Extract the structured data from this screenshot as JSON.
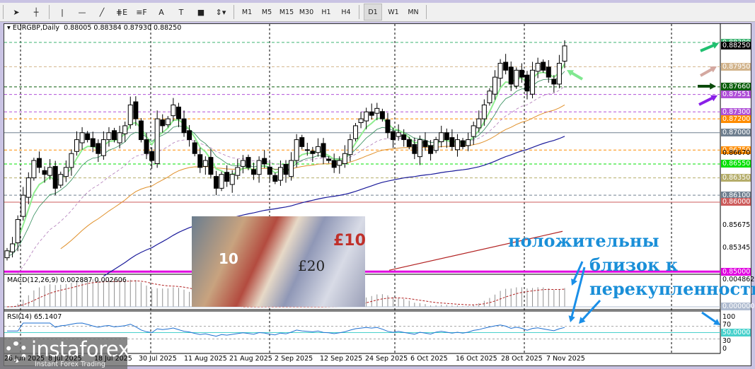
{
  "toolbar": {
    "tools": [
      {
        "name": "cursor-icon",
        "glyph": "➤"
      },
      {
        "name": "crosshair-icon",
        "glyph": "┼"
      },
      {
        "name": "vertical-line-icon",
        "glyph": "|"
      },
      {
        "name": "horizontal-line-icon",
        "glyph": "—"
      },
      {
        "name": "trendline-icon",
        "glyph": "╱"
      },
      {
        "name": "fibonacci-icon",
        "glyph": "⋕E"
      },
      {
        "name": "fibo-levels-icon",
        "glyph": "≡F"
      },
      {
        "name": "text-icon",
        "glyph": "A"
      },
      {
        "name": "text-label-icon",
        "glyph": "T"
      },
      {
        "name": "rectangle-icon",
        "glyph": "■"
      },
      {
        "name": "arrows-dropdown-icon",
        "glyph": "⇕▾"
      }
    ],
    "timeframes": [
      "M1",
      "M5",
      "M15",
      "M30",
      "H1",
      "H4",
      "D1",
      "W1",
      "MN"
    ],
    "active_timeframe": "D1"
  },
  "chart_data": {
    "type": "candlestick",
    "title": "EURGBP,Daily",
    "ohlc_header": "0.88005 0.88384 0.87930 0.88250",
    "ylim": [
      0.8495,
      0.8842
    ],
    "closes": [
      0.853,
      0.854,
      0.8575,
      0.861,
      0.8635,
      0.866,
      0.865,
      0.864,
      0.865,
      0.862,
      0.864,
      0.865,
      0.867,
      0.869,
      0.87,
      0.869,
      0.868,
      0.867,
      0.869,
      0.87,
      0.869,
      0.87,
      0.871,
      0.874,
      0.872,
      0.869,
      0.867,
      0.866,
      0.872,
      0.871,
      0.872,
      0.874,
      0.872,
      0.87,
      0.869,
      0.867,
      0.865,
      0.866,
      0.864,
      0.862,
      0.864,
      0.863,
      0.864,
      0.865,
      0.866,
      0.865,
      0.864,
      0.866,
      0.8655,
      0.864,
      0.863,
      0.865,
      0.864,
      0.866,
      0.869,
      0.868,
      0.8675,
      0.867,
      0.868,
      0.8665,
      0.866,
      0.865,
      0.866,
      0.867,
      0.869,
      0.871,
      0.872,
      0.873,
      0.8725,
      0.8735,
      0.872,
      0.87,
      0.869,
      0.87,
      0.869,
      0.868,
      0.867,
      0.869,
      0.868,
      0.867,
      0.869,
      0.87,
      0.869,
      0.868,
      0.869,
      0.868,
      0.869,
      0.871,
      0.872,
      0.874,
      0.876,
      0.878,
      0.88,
      0.879,
      0.877,
      0.879,
      0.878,
      0.876,
      0.879,
      0.88,
      0.879,
      0.878,
      0.877,
      0.88,
      0.8825
    ],
    "red_trend": [
      0.8502,
      0.8558
    ],
    "levels": [
      {
        "price": 0.883,
        "label": "0.88300",
        "color": "#3cb371",
        "style": "dash"
      },
      {
        "price": 0.8825,
        "label": "0.88250",
        "color": "#000000",
        "style": "none"
      },
      {
        "price": 0.8795,
        "label": "0.87950",
        "color": "#d2b48c",
        "style": "dash"
      },
      {
        "price": 0.8766,
        "label": "0.87660",
        "color": "#0b5e0b",
        "style": "dash"
      },
      {
        "price": 0.87551,
        "label": "0.87551",
        "color": "#b050d8",
        "style": "dash"
      },
      {
        "price": 0.873,
        "label": "0.87300",
        "color": "#b050d8",
        "style": "dash"
      },
      {
        "price": 0.872,
        "label": "0.87200",
        "color": "#ff8c00",
        "style": "dash"
      },
      {
        "price": 0.87,
        "label": "0.87000",
        "color": "#708090",
        "style": "solid"
      },
      {
        "price": 0.8675,
        "label": "0.86750",
        "color": "#ff8c00",
        "style": "dash"
      },
      {
        "price": 0.8655,
        "label": "0.86550",
        "color": "#00e000",
        "style": "dash"
      },
      {
        "price": 0.8635,
        "label": "0.86350",
        "color": "#b5ad6a",
        "style": "dash"
      },
      {
        "price": 0.861,
        "label": "0.86100",
        "color": "#708090",
        "style": "dash"
      },
      {
        "price": 0.86,
        "label": "0.86000",
        "color": "#cd5c5c",
        "style": "solid"
      },
      {
        "price": 0.85,
        "label": "0.85000",
        "color": "#e000e0",
        "style": "thick"
      }
    ],
    "price_ticks": [
      "0.86670",
      "0.85675",
      "0.85345"
    ],
    "macd": {
      "label": "MACD(12,26,9) 0.002887 0.002606",
      "max": "0.004862",
      "zero": "0.000000"
    },
    "rsi": {
      "label": "RSI(14) 65.1407",
      "ticks": [
        "100",
        "70",
        "30",
        "0"
      ],
      "level": "50.0000"
    },
    "xaxis": {
      "labels": [
        "26 Jun 2025",
        "8 Jul 2025",
        "18 Jul 2025",
        "30 Jul 2025",
        "11 Aug 2025",
        "21 Aug 2025",
        "2 Sep 2025",
        "12 Sep 2025",
        "24 Sep 2025",
        "6 Oct 2025",
        "16 Oct 2025",
        "28 Oct 2025",
        "7 Nov 2025"
      ]
    }
  },
  "annotations": {
    "line1": "положительны",
    "line2": "близок к",
    "line3": "перекупленности"
  },
  "photo": {
    "note1": "10",
    "note2": "£20",
    "note3": "£10"
  },
  "logo": {
    "brand": "instaforex",
    "tagline": "Instant Forex Trading"
  }
}
